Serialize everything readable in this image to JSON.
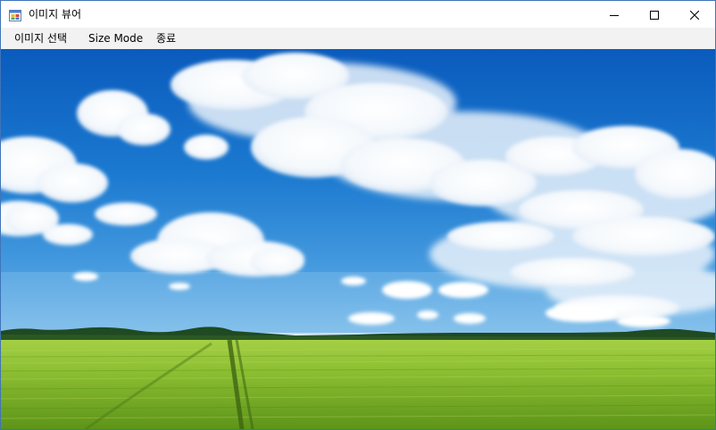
{
  "window": {
    "title": "이미지 뷰어",
    "icon": "windows-forms-app-icon",
    "controls": {
      "minimize_icon": "minimize-icon",
      "maximize_icon": "maximize-icon",
      "close_icon": "close-icon"
    }
  },
  "menu": {
    "items": [
      {
        "label": "이미지 선택"
      },
      {
        "label": "Size Mode"
      },
      {
        "label": "종료"
      }
    ]
  },
  "picture": {
    "subject": "blue sky with clouds over green wheat field",
    "colors": {
      "sky_top": "#0a5fc0",
      "sky_horizon": "#6fb6ea",
      "field_near": "#6aa11e",
      "field_far": "#a9d44a",
      "treeline": "#1f4a22",
      "cloud": "#ffffff"
    }
  }
}
